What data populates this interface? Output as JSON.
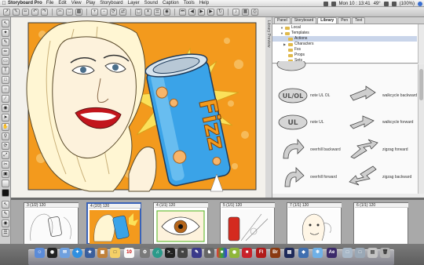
{
  "menubar": {
    "app": "Storyboard Pro",
    "items": [
      "File",
      "Edit",
      "View",
      "Play",
      "Storyboard",
      "Layer",
      "Sound",
      "Caption",
      "Tools",
      "Help"
    ],
    "clock": "Mon 10 : 13:41",
    "temp": "49°",
    "battery": "(100%)"
  },
  "right_panel": {
    "vertical_tab": "Library Preview",
    "tabs": [
      "Panel",
      "Storyboard",
      "Library",
      "Pen",
      "Text"
    ],
    "active_tab": "Library",
    "tree": [
      {
        "label": "Local",
        "indent": 0,
        "expanded": true
      },
      {
        "label": "Templates",
        "indent": 0,
        "expanded": true
      },
      {
        "label": "Actions",
        "indent": 1,
        "selected": true
      },
      {
        "label": "Characters",
        "indent": 1,
        "expanded": false
      },
      {
        "label": "Fxs",
        "indent": 1
      },
      {
        "label": "Props",
        "indent": 1
      },
      {
        "label": "Sets",
        "indent": 1
      }
    ],
    "library_items": [
      {
        "label": "note UL OL",
        "kind": "oval-text",
        "text": "UL/OL"
      },
      {
        "label": "walkcycle backward",
        "kind": "arrow-flat"
      },
      {
        "label": "note UL",
        "kind": "oval-text",
        "text": "UL"
      },
      {
        "label": "walkcycle forward",
        "kind": "arrow-flat"
      },
      {
        "label": "overhill backward",
        "kind": "arrow-curve"
      },
      {
        "label": "zigzag forward",
        "kind": "arrow-zig"
      },
      {
        "label": "overhill forward",
        "kind": "arrow-curve"
      },
      {
        "label": "zigzag backward",
        "kind": "arrow-zig"
      }
    ]
  },
  "stage": {
    "can_text": "Fizz",
    "colors": {
      "orange": "#f39a1d",
      "can_blue": "#3aa3e8",
      "frame_green": "#9fc23c"
    }
  },
  "thumbnails": [
    {
      "label": "3 (1/2) 120"
    },
    {
      "label": "4 (2/2) 120",
      "selected": true
    },
    {
      "label": "4 (1/1) 120"
    },
    {
      "label": "5 (1/1) 120"
    },
    {
      "label": "7 (1/1) 120"
    },
    {
      "label": "6 (1/1) 120"
    }
  ],
  "dock": {
    "apps": [
      "Finder",
      "Dashboard",
      "Mail",
      "Safari",
      "iCal",
      "Preview",
      "iTunes",
      "Terminal",
      "Activity",
      "Flash",
      "Bridge",
      "Photoshop",
      "Illustrator",
      "Finder2",
      "AfterEffects",
      "Downloads",
      "Trash"
    ],
    "labels": {
      "fl": "Fl",
      "br": "Br",
      "ae": "Ae",
      "cal": "10"
    }
  }
}
